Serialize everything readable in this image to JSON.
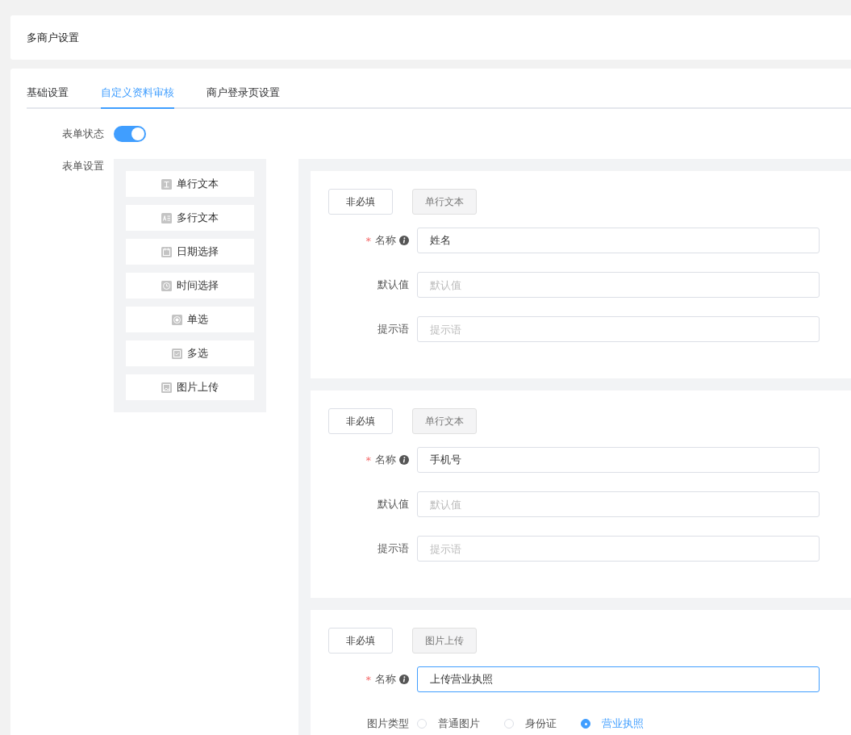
{
  "page_title": "多商户设置",
  "tabs": [
    {
      "label": "基础设置",
      "selected": false
    },
    {
      "label": "自定义资料审核",
      "selected": true
    },
    {
      "label": "商户登录页设置",
      "selected": false
    }
  ],
  "form_status": {
    "label": "表单状态",
    "on": true
  },
  "form_settings_label": "表单设置",
  "palette": [
    {
      "kind": "single-line",
      "label": "单行文本"
    },
    {
      "kind": "multi-line",
      "label": "多行文本"
    },
    {
      "kind": "date",
      "label": "日期选择"
    },
    {
      "kind": "time",
      "label": "时间选择"
    },
    {
      "kind": "radio",
      "label": "单选"
    },
    {
      "kind": "checkbox",
      "label": "多选"
    },
    {
      "kind": "image",
      "label": "图片上传"
    }
  ],
  "cards": [
    {
      "required_button": "非必填",
      "type_tag": "单行文本",
      "fields": [
        {
          "kind": "input",
          "asterisk": "*",
          "label": "名称",
          "info": true,
          "value": "姓名",
          "focused": false
        },
        {
          "kind": "input",
          "label": "默认值",
          "info": false,
          "placeholder": "默认值",
          "focused": false
        },
        {
          "kind": "input",
          "label": "提示语",
          "info": false,
          "placeholder": "提示语",
          "focused": false
        }
      ]
    },
    {
      "required_button": "非必填",
      "type_tag": "单行文本",
      "fields": [
        {
          "kind": "input",
          "asterisk": "*",
          "label": "名称",
          "info": true,
          "value": "手机号",
          "focused": false
        },
        {
          "kind": "input",
          "label": "默认值",
          "info": false,
          "placeholder": "默认值",
          "focused": false
        },
        {
          "kind": "input",
          "label": "提示语",
          "info": false,
          "placeholder": "提示语",
          "focused": false
        }
      ]
    },
    {
      "required_button": "非必填",
      "type_tag": "图片上传",
      "fields": [
        {
          "kind": "input",
          "asterisk": "*",
          "label": "名称",
          "info": true,
          "value": "上传营业执照",
          "focused": true
        },
        {
          "kind": "radios",
          "label": "图片类型",
          "info": false,
          "options": [
            {
              "label": "普通图片",
              "selected": false
            },
            {
              "label": "身份证",
              "selected": false
            },
            {
              "label": "营业执照",
              "selected": true
            }
          ]
        }
      ]
    }
  ]
}
